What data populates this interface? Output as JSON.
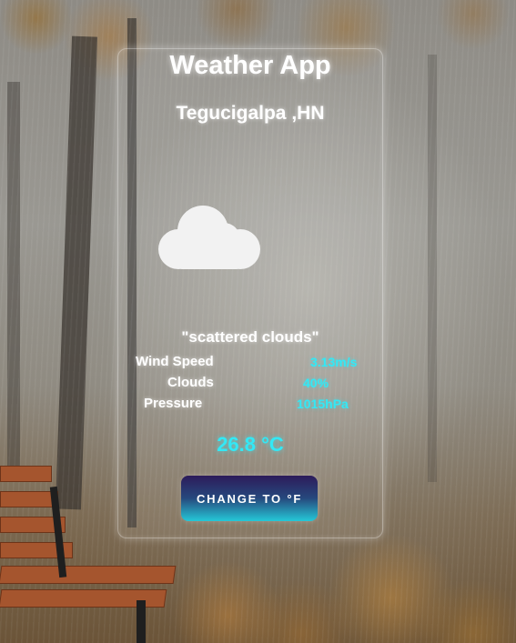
{
  "app": {
    "title": "Weather App",
    "city": "Tegucigalpa ,HN"
  },
  "weather": {
    "icon": "cloud-icon",
    "description": "\"scattered clouds\"",
    "stats": {
      "wind_label": "Wind Speed",
      "wind_value": "3.13m/s",
      "clouds_label": "Clouds",
      "clouds_value": "40%",
      "pressure_label": "Pressure",
      "pressure_value": "1015hPa"
    },
    "temperature": "26.8 °C"
  },
  "actions": {
    "toggle_unit_label": "CHANGE TO °F"
  },
  "colors": {
    "accent": "#33e8f5",
    "text": "#ffffff",
    "button_top": "#2d1b5a",
    "button_bottom": "#25c8d8"
  }
}
